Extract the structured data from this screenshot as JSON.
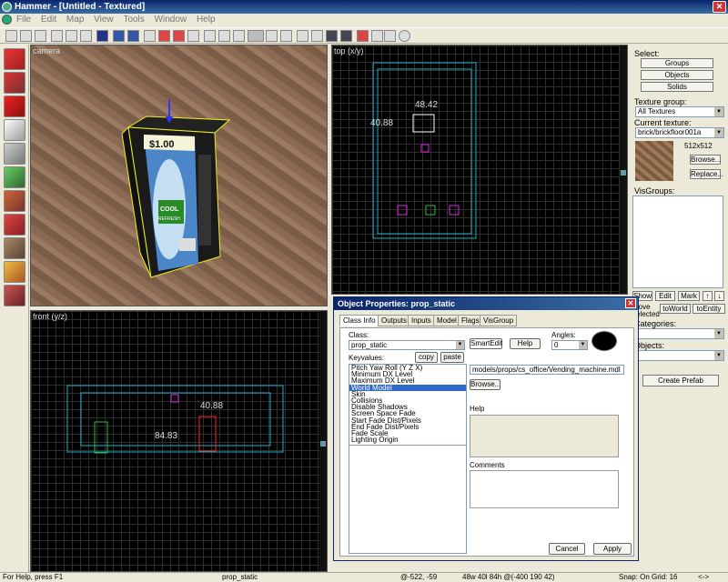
{
  "window": {
    "title": "Hammer - [Untitled - Textured]"
  },
  "menu": [
    "File",
    "Edit",
    "Map",
    "View",
    "Tools",
    "Window",
    "Help"
  ],
  "viewports": {
    "camera": {
      "label": "camera",
      "sign": "$1.00",
      "brand_top": "COOL",
      "brand_bottom": "REFRESH"
    },
    "top": {
      "label": "top (x/y)",
      "dim_width": "48.42",
      "dim_height": "40.88"
    },
    "front": {
      "label": "front (y/z)",
      "dim_width": "40.88",
      "dim_height": "84.83"
    }
  },
  "right_panel": {
    "select_label": "Select:",
    "buttons": [
      "Groups",
      "Objects",
      "Solids"
    ],
    "texture_group_label": "Texture group:",
    "texture_group_value": "All Textures",
    "current_texture_label": "Current texture:",
    "current_texture_value": "brick/brickfloor001a",
    "texture_size": "512x512",
    "browse": "Browse...",
    "replace": "Replace...",
    "visgroups_label": "VisGroups:",
    "row_buttons": [
      "Show",
      "Edit",
      "Mark",
      "↑",
      "↓"
    ],
    "move_selected": "Move\nselected",
    "to_world": "toWorld",
    "to_entity": "toEntity",
    "categories_label": "Categories:",
    "objects_label": "Objects:",
    "create_prefab": "Create Prefab"
  },
  "dialog": {
    "title": "Object Properties: prop_static",
    "close": "✕",
    "tabs": [
      "Class Info",
      "Outputs",
      "Inputs",
      "Model",
      "Flags",
      "VisGroup"
    ],
    "class_label": "Class:",
    "class_value": "prop_static",
    "smartedit": "SmartEdit",
    "help_btn": "Help",
    "angles_label": "Angles:",
    "angles_value": "0",
    "keyvalues_label": "Keyvalues:",
    "copy": "copy",
    "paste": "paste",
    "keyvalues": [
      "Pitch Yaw Roll (Y Z X)",
      "Minimum DX Level",
      "Maximum DX Level",
      "World Model",
      "Skin",
      "Collisions",
      "Disable Shadows",
      "Screen Space Fade",
      "Start Fade Dist/Pixels",
      "End Fade Dist/Pixels",
      "Fade Scale",
      "Lighting Origin"
    ],
    "selected_index": 3,
    "model_value": "models/props/cs_office/Vending_machine.mdl",
    "browse": "Browse...",
    "help_label": "Help",
    "comments_label": "Comments",
    "cancel": "Cancel",
    "apply": "Apply"
  },
  "status": {
    "help": "For Help, press F1",
    "object": "prop_static",
    "coords": "@-522, -59",
    "size": "48w 40l 84h @(-400 190 42)",
    "snap": "Snap: On Grid: 16",
    "arrows": "<->"
  },
  "colors": {
    "title": "#0a246a",
    "selection": "#316ac5",
    "grid_box": "#1ab0c8",
    "selected_outline": "#ff2020",
    "magenta": "#e020e0",
    "green": "#20c040"
  }
}
